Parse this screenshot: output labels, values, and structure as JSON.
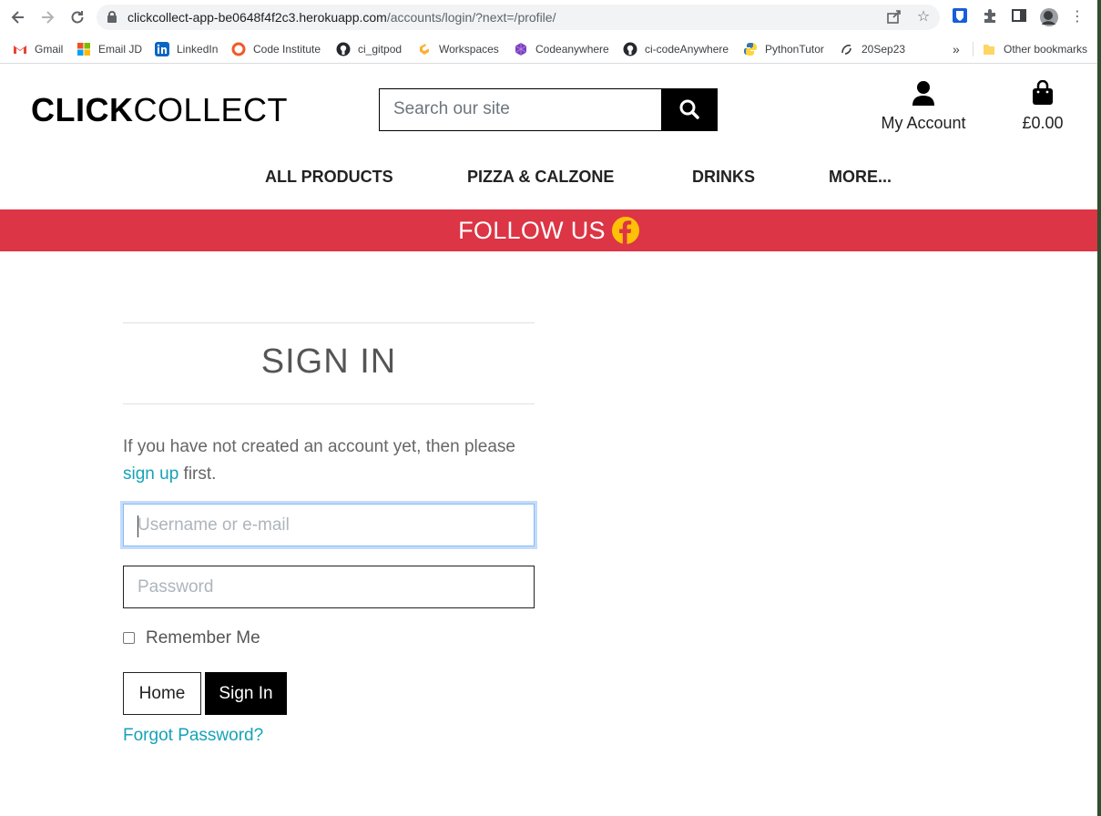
{
  "browser": {
    "url_host": "clickcollect-app-be0648f4f2c3.herokuapp.com",
    "url_path": "/accounts/login/?next=/profile/",
    "bookmarks": [
      "Gmail",
      "Email JD",
      "LinkedIn",
      "Code Institute",
      "ci_gitpod",
      "Workspaces",
      "Codeanywhere",
      "ci-codeAnywhere",
      "PythonTutor",
      "20Sep23"
    ],
    "overflow_label": "»",
    "other_bookmarks": "Other bookmarks"
  },
  "site": {
    "logo_bold": "CLICK",
    "logo_light": "COLLECT",
    "search_placeholder": "Search our site",
    "account_label": "My Account",
    "bag_total": "£0.00",
    "nav": [
      "ALL PRODUCTS",
      "PIZZA & CALZONE",
      "DRINKS",
      "MORE..."
    ],
    "banner_text": "FOLLOW US",
    "colors": {
      "banner": "#dc3545",
      "link": "#17a2b8"
    }
  },
  "signin": {
    "title": "SIGN IN",
    "intro_before": "If you have not created an account yet, then please",
    "signup_link": "sign up",
    "intro_after": " first.",
    "username_placeholder": "Username or e-mail",
    "password_placeholder": "Password",
    "remember_label": "Remember Me",
    "home_button": "Home",
    "signin_button": "Sign In",
    "forgot_link": "Forgot Password?"
  }
}
